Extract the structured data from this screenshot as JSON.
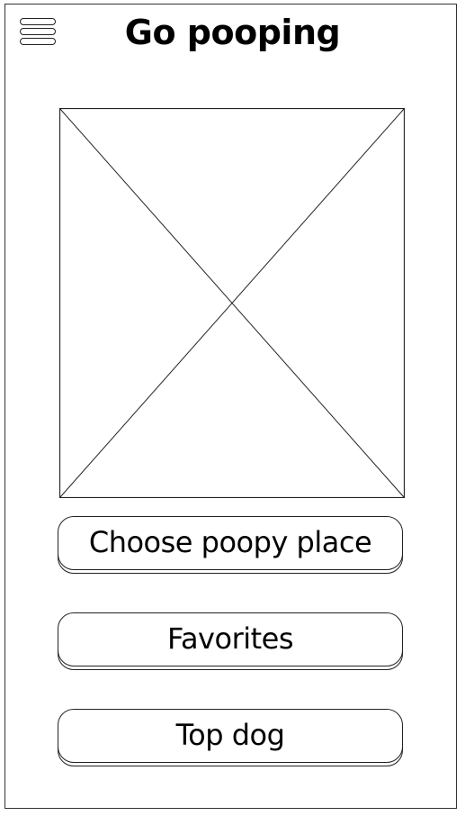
{
  "header": {
    "menu_icon": "hamburger-menu-icon",
    "title": "Go pooping"
  },
  "main": {
    "image_placeholder": "image-placeholder-icon",
    "buttons": [
      {
        "label": "Choose poopy place"
      },
      {
        "label": "Favorites"
      },
      {
        "label": "Top dog"
      }
    ]
  },
  "colors": {
    "outline": "#222222",
    "background": "#ffffff"
  }
}
